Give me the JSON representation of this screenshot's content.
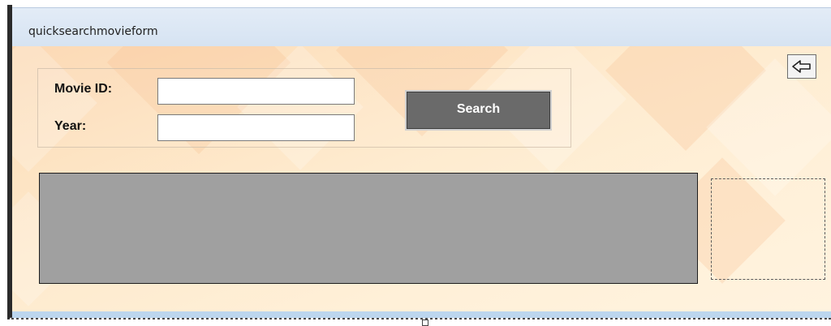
{
  "window": {
    "title": "quicksearchmovieform"
  },
  "form": {
    "movie_id_label": "Movie ID:",
    "movie_id_value": "",
    "year_label": "Year:",
    "year_value": "",
    "search_label": "Search"
  },
  "icons": {
    "back": "back-arrow-icon"
  },
  "colors": {
    "search_button_bg": "#6a6a6a",
    "results_grid_bg": "#a0a0a0",
    "title_bar_bg": "#dde8f4",
    "form_background": "#fde3c2"
  }
}
